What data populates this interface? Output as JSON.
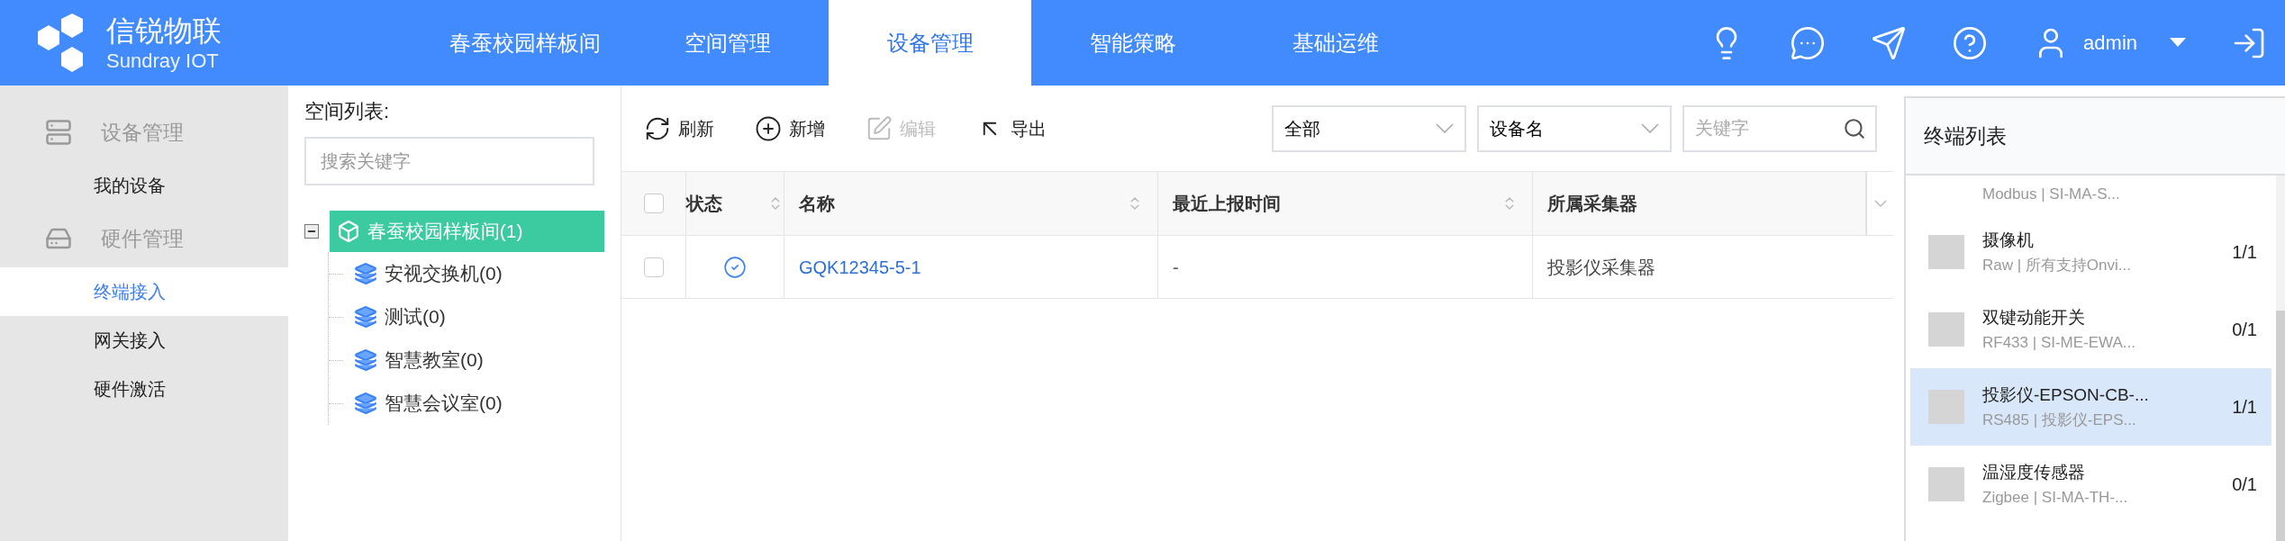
{
  "logo": {
    "title": "信锐物联",
    "subtitle": "Sundray IOT"
  },
  "nav": [
    {
      "label": "春蚕校园样板间",
      "selected": false
    },
    {
      "label": "空间管理",
      "selected": false
    },
    {
      "label": "设备管理",
      "selected": true
    },
    {
      "label": "智能策略",
      "selected": false
    },
    {
      "label": "基础运维",
      "selected": false
    }
  ],
  "user": {
    "name": "admin"
  },
  "sidebar": [
    {
      "kind": "group",
      "label": "设备管理"
    },
    {
      "kind": "item",
      "label": "我的设备",
      "selected": false
    },
    {
      "kind": "group",
      "label": "硬件管理"
    },
    {
      "kind": "item",
      "label": "终端接入",
      "selected": true
    },
    {
      "kind": "item",
      "label": "网关接入",
      "selected": false
    },
    {
      "kind": "item",
      "label": "硬件激活",
      "selected": false
    }
  ],
  "space_list": {
    "title": "空间列表:",
    "search": {
      "placeholder": "搜索关键字"
    },
    "tree": {
      "label": "春蚕校园样板间(1)",
      "expanded": true,
      "selected": true,
      "children": [
        {
          "label": "安视交换机(0)",
          "selected": false
        },
        {
          "label": "测试(0)",
          "selected": false
        },
        {
          "label": "智慧教室(0)",
          "selected": false
        },
        {
          "label": "智慧会议室(0)",
          "selected": false
        }
      ]
    }
  },
  "toolbar": [
    {
      "kind": "refresh",
      "label": "刷新",
      "disabled": false
    },
    {
      "kind": "add",
      "label": "新增",
      "disabled": false
    },
    {
      "kind": "edit",
      "label": "编辑",
      "disabled": true
    },
    {
      "kind": "export",
      "label": "导出",
      "disabled": false
    }
  ],
  "filters": {
    "status": "全部",
    "field": "设备名",
    "keyword": {
      "placeholder": "关键字"
    }
  },
  "table": {
    "select_all": {
      "checked": false
    },
    "columns": [
      {
        "label": "状态",
        "sortable": true
      },
      {
        "label": "名称",
        "sortable": true
      },
      {
        "label": "最近上报时间",
        "sortable": true
      },
      {
        "label": "所属采集器",
        "sortable": false
      }
    ],
    "rows": [
      {
        "checked": false,
        "online": true,
        "name": "GQK12345-5-1",
        "last_report": "-",
        "collector": "投影仪采集器"
      }
    ]
  },
  "terminal_list": {
    "title": "终端列表",
    "items": [
      {
        "detail": "Modbus | SI-MA-S...",
        "selected": false
      },
      {
        "name": "摄像机",
        "detail": "Raw | 所有支持Onvi...",
        "count": "1/1",
        "selected": false
      },
      {
        "name": "双键动能开关",
        "detail": "RF433 | SI-ME-EWA...",
        "count": "0/1",
        "selected": false
      },
      {
        "name": "投影仪-EPSON-CB-...",
        "detail": "RS485 | 投影仪-EPS...",
        "count": "1/1",
        "selected": true
      },
      {
        "name": "温湿度传感器",
        "detail": "Zigbee | SI-MA-TH-...",
        "count": "0/1",
        "selected": false
      }
    ]
  }
}
